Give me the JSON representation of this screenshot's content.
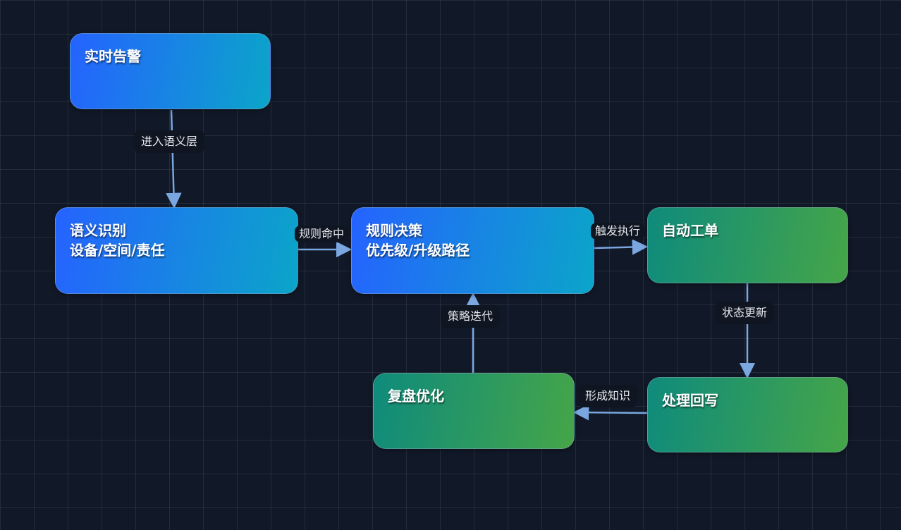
{
  "nodes": {
    "alert": {
      "line1": "实时告警"
    },
    "semantic": {
      "line1": "语义识别",
      "line2": "设备/空间/责任"
    },
    "rule": {
      "line1": "规则决策",
      "line2": "优先级/升级路径"
    },
    "ticket": {
      "line1": "自动工单"
    },
    "writeback": {
      "line1": "处理回写"
    },
    "review": {
      "line1": "复盘优化"
    }
  },
  "edges": {
    "alert_to_semantic": "进入语义层",
    "semantic_to_rule": "规则命中",
    "rule_to_ticket": "触发执行",
    "ticket_to_writeback": "状态更新",
    "writeback_to_review": "形成知识",
    "review_to_rule": "策略迭代"
  },
  "colors": {
    "background": "#111827",
    "edge": "#7aa7e0",
    "blue_node_start": "#2563ff",
    "blue_node_end": "#0ba5c9",
    "green_node_start": "#0f8b7c",
    "green_node_end": "#45a548"
  }
}
